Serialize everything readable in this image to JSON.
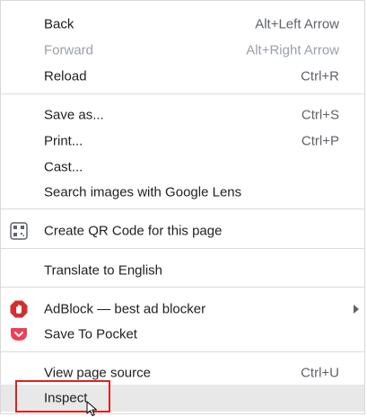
{
  "menu": {
    "items": [
      {
        "label": "Back",
        "shortcut": "Alt+Left Arrow",
        "enabled": true
      },
      {
        "label": "Forward",
        "shortcut": "Alt+Right Arrow",
        "enabled": false
      },
      {
        "label": "Reload",
        "shortcut": "Ctrl+R",
        "enabled": true
      },
      {
        "label": "Save as...",
        "shortcut": "Ctrl+S",
        "enabled": true
      },
      {
        "label": "Print...",
        "shortcut": "Ctrl+P",
        "enabled": true
      },
      {
        "label": "Cast...",
        "enabled": true
      },
      {
        "label": "Search images with Google Lens",
        "enabled": true
      },
      {
        "label": "Create QR Code for this page",
        "icon": "qr-code-icon",
        "enabled": true
      },
      {
        "label": "Translate to English",
        "enabled": true
      },
      {
        "label": "AdBlock — best ad blocker",
        "icon": "adblock-hand-icon",
        "has_submenu": true,
        "enabled": true
      },
      {
        "label": "Save To Pocket",
        "icon": "pocket-icon",
        "enabled": true
      },
      {
        "label": "View page source",
        "shortcut": "Ctrl+U",
        "enabled": true
      },
      {
        "label": "Inspect",
        "enabled": true,
        "hovered": true,
        "annotated": true
      }
    ]
  },
  "colors": {
    "text": "#202124",
    "shortcut_text": "#5f6368",
    "disabled_text": "#9aa0a6",
    "separator": "#dadce0",
    "hover_background": "#e8e8e8",
    "annotation_border": "#e02020",
    "adblock_red": "#d32f2f",
    "pocket_red": "#ef4056"
  }
}
